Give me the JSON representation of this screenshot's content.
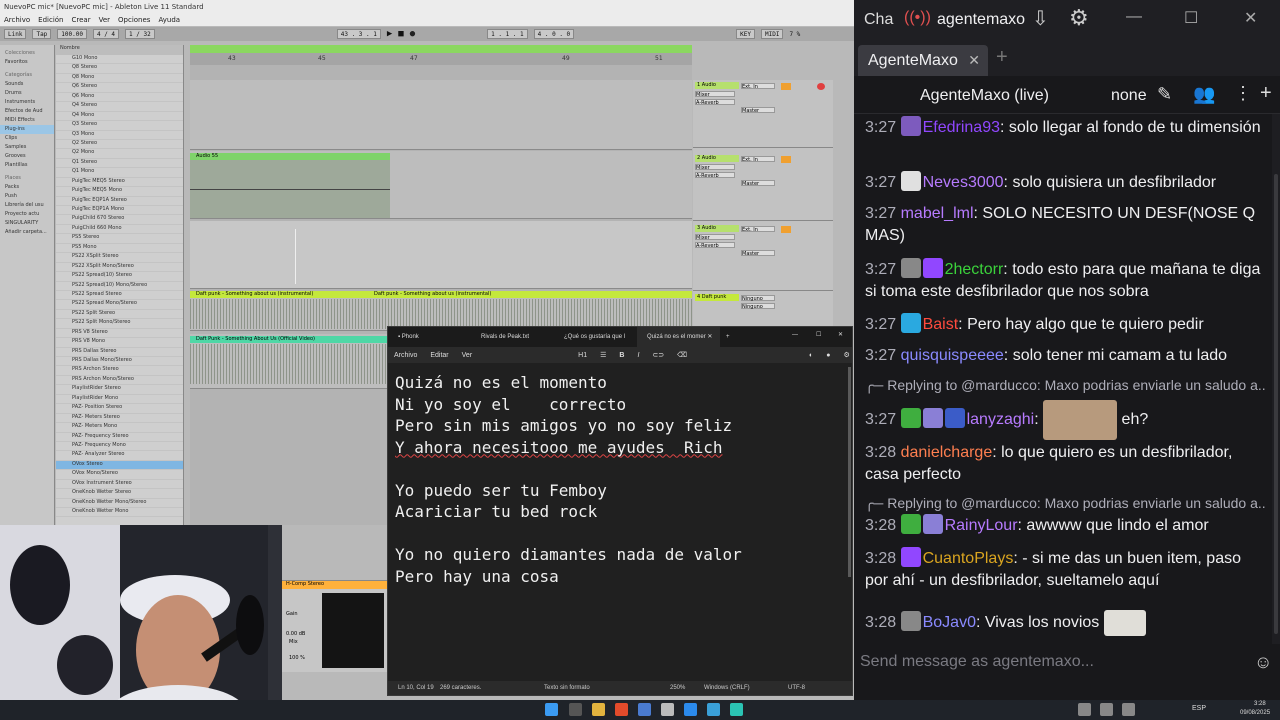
{
  "ableton": {
    "title": "NuevoPC mic* [NuevoPC mic] - Ableton Live 11 Standard",
    "menu": [
      "Archivo",
      "Edición",
      "Crear",
      "Ver",
      "Opciones",
      "Ayuda"
    ],
    "transport": {
      "link": "Link",
      "tap": "Tap",
      "tempo": "100.00",
      "signature": "4 / 4",
      "quant": "1 / 32",
      "position": "43 . 3 . 1",
      "loop_start": "1 . 1 . 1",
      "loop_len": "4 . 0 . 0",
      "key": "KEY",
      "midi": "MIDI",
      "cpu": "7 %"
    },
    "browser": {
      "collections_label": "Colecciones",
      "favorites": "Favoritos",
      "categories_label": "Categorías",
      "categories": [
        "Sounds",
        "Drums",
        "Instruments",
        "Efectos de Aud",
        "MIDI Effects",
        "Plug-ins",
        "Clips",
        "Samples",
        "Grooves",
        "Plantillas"
      ],
      "places_label": "Places",
      "places": [
        "Packs",
        "Push",
        "Librería del usu",
        "Proyecto actu",
        "SINGULARITY",
        "Añadir carpeta..."
      ],
      "selected": "Plug-ins"
    },
    "list_header": "Nombre",
    "list_items": [
      "G10 Mono",
      "Q8 Stereo",
      "Q8 Mono",
      "Q6 Stereo",
      "Q6 Mono",
      "Q4 Stereo",
      "Q4 Mono",
      "Q3 Stereo",
      "Q3 Mono",
      "Q2 Stereo",
      "Q2 Mono",
      "Q1 Stereo",
      "Q1 Mono",
      "PuigTec MEQ5 Stereo",
      "PuigTec MEQ5 Mono",
      "PuigTec EQP1A Stereo",
      "PuigTec EQP1A Mono",
      "PuigChild 670 Stereo",
      "PuigChild 660 Mono",
      "PS5 Stereo",
      "PS5 Mono",
      "PS22 XSplit Stereo",
      "PS22 XSplit Mono/Stereo",
      "PS22 Spread(10) Stereo",
      "PS22 Spread(10) Mono/Stereo",
      "PS22 Spread Stereo",
      "PS22 Spread Mono/Stereo",
      "PS22 Split Stereo",
      "PS22 Split Mono/Stereo",
      "PRS V8 Stereo",
      "PRS V8 Mono",
      "PRS Dallas Stereo",
      "PRS Dallas Mono/Stereo",
      "PRS Archon Stereo",
      "PRS Archon Mono/Stereo",
      "PlaylistRider Stereo",
      "PlaylistRider Mono",
      "PAZ- Position Stereo",
      "PAZ- Meters Stereo",
      "PAZ- Meters Mono",
      "PAZ- Frequency Stereo",
      "PAZ- Frequency Mono",
      "PAZ- Analyzer Stereo",
      "OVox Stereo",
      "OVox Mono/Stereo",
      "OVox Instrument Stereo",
      "OneKnob Wetter Stereo",
      "OneKnob Wetter Mono/Stereo",
      "OneKnob Wetter Mono"
    ],
    "ruler": [
      "43",
      "45",
      "47",
      "49",
      "51"
    ],
    "clips": {
      "audio_clip": "Audio 55",
      "daft1": "Daft punk - Something about us (instrumental)",
      "daft2": "Daft punk - Something about us (instrumental)",
      "daft_video": "Daft Punk - Something About Us (Official Video)"
    },
    "tracks": [
      {
        "name": "1 Audio",
        "input": "Ext. In",
        "mixer": "Mixer",
        "send": "A-Reverb",
        "out": "Master"
      },
      {
        "name": "2 Audio",
        "input": "Ext. In",
        "mixer": "Mixer",
        "send": "A-Reverb",
        "out": "Master"
      },
      {
        "name": "3 Audio",
        "input": "Ext. In",
        "mixer": "Mixer",
        "send": "A-Reverb",
        "out": "Master"
      },
      {
        "name": "4 Daft punk",
        "input": "Ninguno",
        "mixer": "Ninguno",
        "send": "",
        "out": ""
      }
    ],
    "device": {
      "title": "H-Comp Stereo",
      "knob1": "0.00 dB",
      "knob2": "100 %",
      "mix": "Mix",
      "gain": "Gain"
    }
  },
  "notepad": {
    "tabs": [
      "Phonk",
      "Rivals de Peak.txt",
      "¿Qué os gustaría que l",
      "Quizá no es el momer"
    ],
    "active_tab": 3,
    "menu": [
      "Archivo",
      "Editar",
      "Ver"
    ],
    "heading": "H1",
    "lines": [
      "Quizá no es el momento",
      "Ni yo soy el    correcto",
      "Pero sin mis amigos yo no soy feliz",
      "Y ahora necesitooo me ayudes  Rich",
      "",
      "Yo puedo ser tu Femboy",
      "Acariciar tu bed rock",
      "",
      "Yo no quiero diamantes nada de valor",
      "Pero hay una cosa"
    ],
    "status": {
      "position": "Ln 10, Col 19",
      "chars": "269 caracteres.",
      "format": "Texto sin formato",
      "zoom": "250%",
      "eol": "Windows (CRLF)",
      "encoding": "UTF-8"
    }
  },
  "chat": {
    "top_title": "Cha",
    "live_name": "agentemaxo",
    "tab_label": "AgenteMaxo",
    "header_title": "AgenteMaxo (live)",
    "mode": "none",
    "messages": [
      {
        "time": "3:27",
        "user": "Efedrina93",
        "color": "#9147ff",
        "text": " solo llegar al fondo de tu dimensión",
        "badges": [
          "#7d5bbe"
        ]
      },
      {
        "time": "3:27",
        "user": "Neves3000",
        "color": "#b77bff",
        "text": " solo quisiera un desfibrilador",
        "badges": [
          "#e0e0e0"
        ]
      },
      {
        "time": "3:27",
        "user": "mabel_lml",
        "color": "#b77bff",
        "text": " SOLO NECESITO UN DESF(NOSE Q MAS)",
        "badges": []
      },
      {
        "time": "3:27",
        "user": "2hectorr",
        "color": "#3bd23b",
        "text": " todo esto para que mañana te diga si toma este desfibrilador que nos sobra",
        "badges": [
          "#888888",
          "#9147ff"
        ]
      },
      {
        "time": "3:27",
        "user": "Baist",
        "color": "#ff4b3e",
        "text": " Pero hay algo que te quiero pedir",
        "badges": [
          "#2aa9e0"
        ]
      },
      {
        "time": "3:27",
        "user": "quisquispeeee",
        "color": "#8a8aff",
        "text": " solo tener mi camam a tu lado",
        "badges": []
      },
      {
        "time": "3:27",
        "user": "lanyzaghi",
        "color": "#b77bff",
        "text": " eh?",
        "badges": [
          "#3fae3f",
          "#8a7fd6",
          "#3b5cc8"
        ],
        "reply": "Replying to @marducco: Maxo podrias enviarle un saludo a..."
      },
      {
        "time": "3:28",
        "user": "danielcharge",
        "color": "#ff7f50",
        "text": " lo que quiero es un desfibrilador, casa perfecto",
        "badges": []
      },
      {
        "time": "3:28",
        "user": "RainyLour",
        "color": "#b77bff",
        "text": " awwww que lindo el amor",
        "badges": [
          "#3fae3f",
          "#8a7fd6"
        ],
        "reply": "Replying to @marducco: Maxo podrias enviarle un saludo a..."
      },
      {
        "time": "3:28",
        "user": "CuantoPlays",
        "color": "#daa520",
        "text": " - si me das un buen item, paso por ahí - un desfibrilador, sueltamelo aquí",
        "badges": [
          "#9147ff"
        ]
      },
      {
        "time": "3:28",
        "user": "BoJav0",
        "color": "#8a8aff",
        "text": " Vivas los novios",
        "badges": [
          "#888888"
        ]
      }
    ],
    "input_placeholder": "Send message as agentemaxo..."
  },
  "taskbar": {
    "lang": "ESP",
    "time": "3:28",
    "date": "09/08/2025"
  }
}
